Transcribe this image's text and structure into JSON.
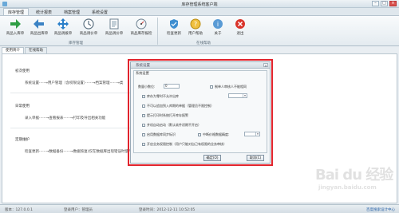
{
  "window": {
    "title": "库存管理系统客户端"
  },
  "ribbon_tabs": [
    "库存管理",
    "统计报表",
    "档案管理",
    "系统设置"
  ],
  "ribbon_buttons": {
    "stock_in": "商品入库单",
    "stock_out": "商品出库单",
    "transfer": "商品调拨单",
    "price_adjust": "商品调价单",
    "stock_report": "商品库存报检",
    "check_update": "检查更新",
    "help": "用户帮助",
    "about": "关于",
    "exit": "退出"
  },
  "ribbon_groups": {
    "inventory": "库存管理",
    "online_help": "在线帮助"
  },
  "content_tabs": [
    "使用简介",
    "在线帮助"
  ],
  "guide": {
    "first_use": {
      "title": "初次使用",
      "flow": "系统设置·····→用户管理（含权限设置）······→档案管理······→类"
    },
    "daily_use": {
      "title": "日常使用",
      "flow": "录入单据······→查看报表······→打印及导出相关功能"
    },
    "maintenance": {
      "title": "定期维护",
      "flow": "检查更新······→数据备份······→数据恢复(仅在数据库出现错误时使用)"
    }
  },
  "modal": {
    "title": "系统设置",
    "close_glyph": "✕",
    "group_title": "系统设置",
    "decimal_label": "数量小数位:",
    "decimal_value": "0",
    "options": {
      "o1": "库存为零时不允许出库",
      "o2": "不可以追加到入库期的单据（管理员不限控制）",
      "o3": "提示打印时系统打开库存报警",
      "o4": "并机自动启动（默认软件初期不开启）",
      "o5": "启用数据库同步标识",
      "o6": "开启业务权限控制（用户只能对自己有权限的业务审核）",
      "r1": "制单人审核人不能相同",
      "r2": "中断价格数据精度:"
    },
    "select_arrow": "▾",
    "ok_button": "确定(O)",
    "cancel_button": "取消(C)"
  },
  "statusbar": {
    "version": "版本：127.0.0.1",
    "user": "登录用户：管理员",
    "time": "登录时间：2012-12-11 10:52:05",
    "link": "百度搜索设计中心"
  },
  "watermark": {
    "line1": "Bai du 经验",
    "line2": "jingyan.baidu.com"
  },
  "colors": {
    "accent_red": "#e1232c",
    "ribbon_bg": "#e4ebf0"
  }
}
